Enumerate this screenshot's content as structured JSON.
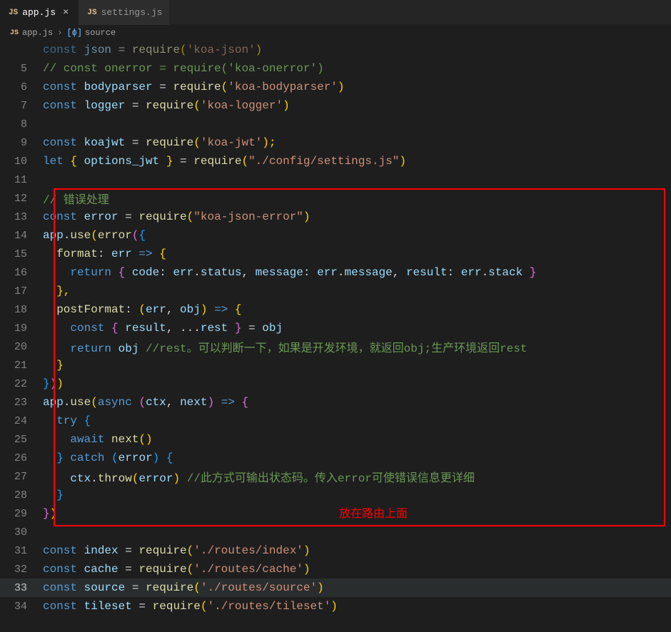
{
  "tabs": {
    "active": {
      "icon": "JS",
      "label": "app.js"
    },
    "inactive": {
      "icon": "JS",
      "label": "settings.js"
    }
  },
  "breadcrumb": {
    "icon": "JS",
    "file": "app.js",
    "symIcon": "[ϕ]",
    "symbol": "source"
  },
  "lines": {
    "l5": "// const onerror = require('koa-onerror')",
    "l6_kw": "const ",
    "l6_v": "bodyparser",
    "l6_eq": " = ",
    "l6_fn": "require",
    "l6_p1": "(",
    "l6_s": "'koa-bodyparser'",
    "l6_p2": ")",
    "l7_kw": "const ",
    "l7_v": "logger",
    "l7_eq": " = ",
    "l7_fn": "require",
    "l7_p1": "(",
    "l7_s": "'koa-logger'",
    "l7_p2": ")",
    "l9_kw": "const ",
    "l9_v": "koajwt",
    "l9_eq": " = ",
    "l9_fn": "require",
    "l9_p1": "(",
    "l9_s": "'koa-jwt'",
    "l9_p2": ");",
    "l10_kw": "let ",
    "l10_b1": "{ ",
    "l10_v": "options_jwt",
    "l10_b2": " }",
    "l10_eq": " = ",
    "l10_fn": "require",
    "l10_p1": "(",
    "l10_s": "\"./config/settings.js\"",
    "l10_p2": ")",
    "l12": "// 错误处理",
    "l13_kw": "const ",
    "l13_v": "error",
    "l13_eq": " = ",
    "l13_fn": "require",
    "l13_p1": "(",
    "l13_s": "\"koa-json-error\"",
    "l13_p2": ")",
    "l14_a": "app",
    "l14_d": ".",
    "l14_u": "use",
    "l14_p1": "(",
    "l14_e": "error",
    "l14_p2": "(",
    "l14_b": "{",
    "l15_k": "format",
    "l15_c": ": ",
    "l15_v": "err",
    "l15_ar": " => ",
    "l15_b": "{",
    "l16_r": "return ",
    "l16_b1": "{ ",
    "l16_k1": "code",
    "l16_c1": ": ",
    "l16_v1": "err",
    "l16_d1": ".",
    "l16_p1": "status",
    "l16_cm1": ", ",
    "l16_k2": "message",
    "l16_c2": ": ",
    "l16_v2": "err",
    "l16_d2": ".",
    "l16_p2": "message",
    "l16_cm2": ", ",
    "l16_k3": "result",
    "l16_c3": ": ",
    "l16_v3": "err",
    "l16_d3": ".",
    "l16_p3": "stack",
    "l16_b2": " }",
    "l17": "},",
    "l18_k": "postFormat",
    "l18_c": ": ",
    "l18_p1": "(",
    "l18_v1": "err",
    "l18_cm": ", ",
    "l18_v2": "obj",
    "l18_p2": ")",
    "l18_ar": " => ",
    "l18_b": "{",
    "l19_kw": "const ",
    "l19_b1": "{ ",
    "l19_v1": "result",
    "l19_cm": ", ",
    "l19_sp": "...",
    "l19_v2": "rest",
    "l19_b2": " }",
    "l19_eq": " = ",
    "l19_v3": "obj",
    "l20_r": "return ",
    "l20_v": "obj",
    "l20_sp": " ",
    "l20_c": "//rest。可以判断一下，如果是开发环境，就返回obj;生产环境返回rest",
    "l21": "}",
    "l22_b": "}",
    "l22_p1": ")",
    "l22_p2": ")",
    "l23_a": "app",
    "l23_d": ".",
    "l23_u": "use",
    "l23_p1": "(",
    "l23_as": "async ",
    "l23_p2": "(",
    "l23_v1": "ctx",
    "l23_cm": ", ",
    "l23_v2": "next",
    "l23_p3": ")",
    "l23_ar": " => ",
    "l23_b": "{",
    "l24_t": "try ",
    "l24_b": "{",
    "l25_aw": "await ",
    "l25_fn": "next",
    "l25_p": "()",
    "l26_b1": "}",
    "l26_c": " catch ",
    "l26_p1": "(",
    "l26_v": "error",
    "l26_p2": ") ",
    "l26_b2": "{",
    "l27_v": "ctx",
    "l27_d": ".",
    "l27_fn": "throw",
    "l27_p1": "(",
    "l27_a": "error",
    "l27_p2": ")",
    "l27_sp": " ",
    "l27_c": "//此方式可输出状态码。传入error可使错误信息更详细",
    "l28": "}",
    "l29_b": "}",
    "l29_p": ")",
    "l31_kw": "const ",
    "l31_v": "index",
    "l31_eq": " = ",
    "l31_fn": "require",
    "l31_p1": "(",
    "l31_s": "'./routes/index'",
    "l31_p2": ")",
    "l32_kw": "const ",
    "l32_v": "cache",
    "l32_eq": " = ",
    "l32_fn": "require",
    "l32_p1": "(",
    "l32_s": "'./routes/cache'",
    "l32_p2": ")",
    "l33_kw": "const ",
    "l33_v": "source",
    "l33_eq": " = ",
    "l33_fn": "require",
    "l33_p1": "(",
    "l33_s": "'./routes/source'",
    "l33_p2": ")",
    "l34_kw": "const ",
    "l34_v": "tileset",
    "l34_eq": " = ",
    "l34_fn": "require",
    "l34_p1": "(",
    "l34_s": "'./routes/tileset'",
    "l34_p2": ")"
  },
  "annotation": "放在路由上面",
  "numbers": {
    "n5": "5",
    "n6": "6",
    "n7": "7",
    "n8": "8",
    "n9": "9",
    "n10": "10",
    "n11": "11",
    "n12": "12",
    "n13": "13",
    "n14": "14",
    "n15": "15",
    "n16": "16",
    "n17": "17",
    "n18": "18",
    "n19": "19",
    "n20": "20",
    "n21": "21",
    "n22": "22",
    "n23": "23",
    "n24": "24",
    "n25": "25",
    "n26": "26",
    "n27": "27",
    "n28": "28",
    "n29": "29",
    "n30": "30",
    "n31": "31",
    "n32": "32",
    "n33": "33",
    "n34": "34"
  }
}
